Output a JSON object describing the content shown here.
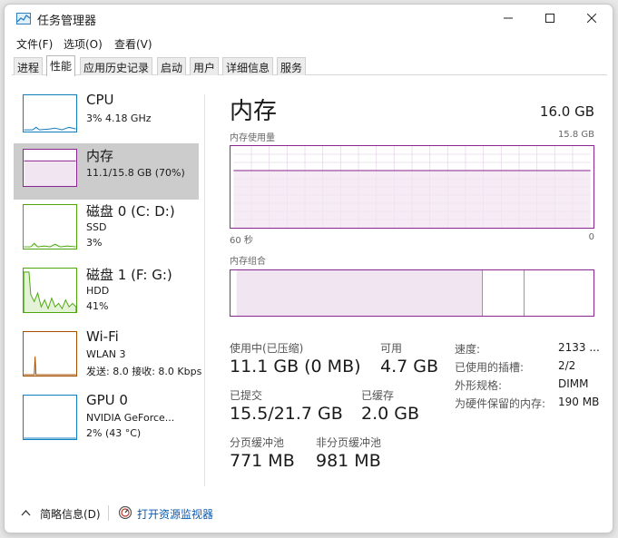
{
  "window": {
    "title": "任务管理器"
  },
  "menu": [
    {
      "label": "文件(F)"
    },
    {
      "label": "选项(O)"
    },
    {
      "label": "查看(V)"
    }
  ],
  "tabs": [
    {
      "label": "进程"
    },
    {
      "label": "性能",
      "active": true
    },
    {
      "label": "应用历史记录"
    },
    {
      "label": "启动"
    },
    {
      "label": "用户"
    },
    {
      "label": "详细信息"
    },
    {
      "label": "服务"
    }
  ],
  "sidebar": {
    "items": [
      {
        "title": "CPU",
        "line1": "3% 4.18 GHz",
        "line2": ""
      },
      {
        "title": "内存",
        "line1": "11.1/15.8 GB (70%)",
        "line2": ""
      },
      {
        "title": "磁盘 0 (C: D:)",
        "line1": "SSD",
        "line2": "3%"
      },
      {
        "title": "磁盘 1 (F: G:)",
        "line1": "HDD",
        "line2": "41%"
      },
      {
        "title": "Wi-Fi",
        "line1": "WLAN 3",
        "line2": "发送: 8.0 接收: 8.0 Kbps"
      },
      {
        "title": "GPU 0",
        "line1": "NVIDIA GeForce...",
        "line2": "2% (43 °C)"
      }
    ]
  },
  "memory": {
    "title": "内存",
    "capacity": "16.0 GB",
    "usage_label": "内存使用量",
    "usage_max": "15.8 GB",
    "time_label": "60 秒",
    "time_end": "0",
    "usage_fraction": 0.7,
    "composition_label": "内存组合",
    "composition": {
      "in_use": 0.7,
      "modified": 0.12
    },
    "stats": {
      "in_use_label": "使用中(已压缩)",
      "in_use_value": "11.1 GB (0 MB)",
      "available_label": "可用",
      "available_value": "4.7 GB",
      "committed_label": "已提交",
      "committed_value": "15.5/21.7 GB",
      "cached_label": "已缓存",
      "cached_value": "2.0 GB",
      "paged_label": "分页缓冲池",
      "paged_value": "771 MB",
      "nonpaged_label": "非分页缓冲池",
      "nonpaged_value": "981 MB"
    },
    "details": [
      {
        "label": "速度:",
        "value": "2133 ..."
      },
      {
        "label": "已使用的插槽:",
        "value": "2/2"
      },
      {
        "label": "外形规格:",
        "value": "DIMM"
      },
      {
        "label": "为硬件保留的内存:",
        "value": "190 MB"
      }
    ]
  },
  "footer": {
    "summary_label": "简略信息(D)",
    "monitor_label": "打开资源监视器"
  },
  "colors": {
    "memory_accent": "#8b2591",
    "cpu_accent": "#117dbb",
    "disk_accent": "#4da60c",
    "wifi_accent": "#a74f01"
  }
}
